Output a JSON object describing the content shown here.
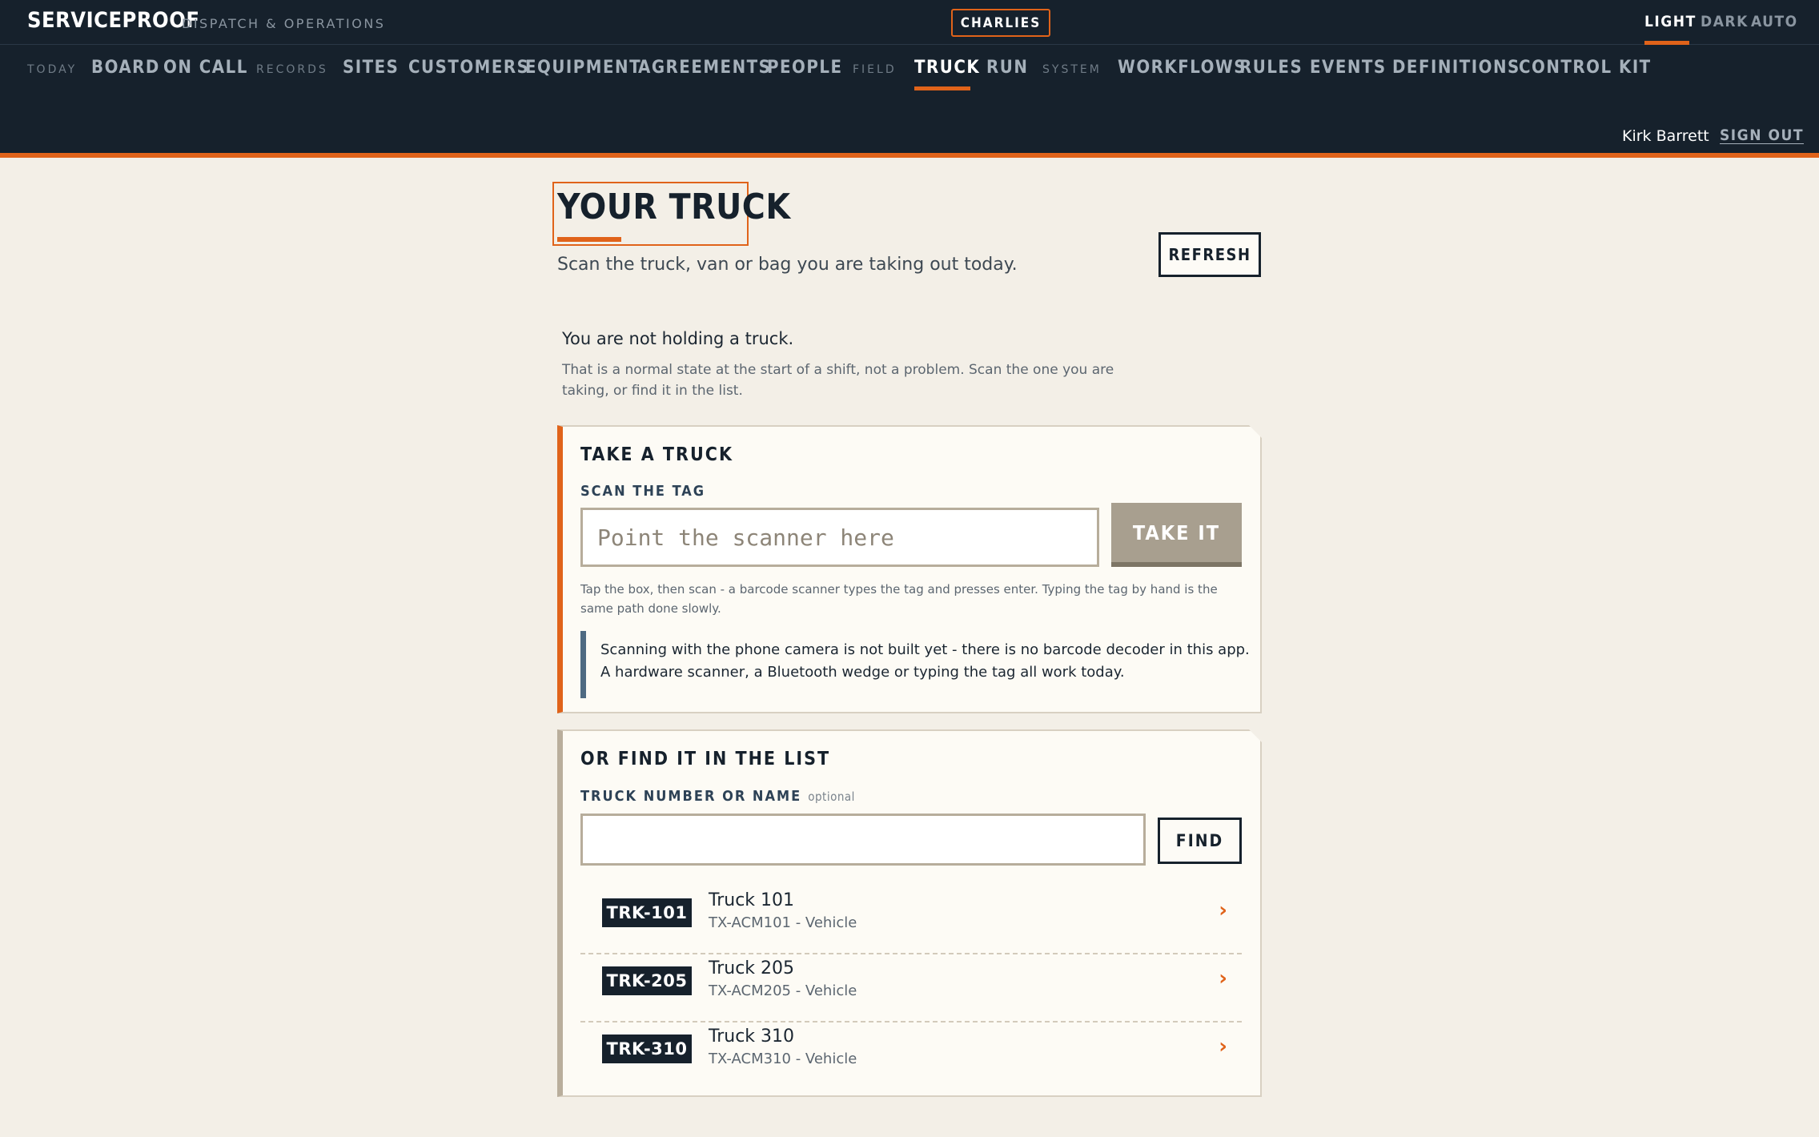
{
  "brand": {
    "name": "SERVICEPROOF",
    "tagline": "DISPATCH & OPERATIONS",
    "tenant": "CHARLIES"
  },
  "theme": {
    "options": [
      "LIGHT",
      "DARK",
      "AUTO"
    ],
    "active": "LIGHT"
  },
  "nav": {
    "groups": {
      "today": "TODAY",
      "records": "RECORDS",
      "field": "FIELD",
      "system": "SYSTEM"
    },
    "items": {
      "board": "BOARD",
      "on_call": "ON CALL",
      "sites": "SITES",
      "customers": "CUSTOMERS",
      "equipment": "EQUIPMENT",
      "agreements": "AGREEMENTS",
      "people": "PEOPLE",
      "truck": "TRUCK",
      "run": "RUN",
      "workflows": "WORKFLOWS",
      "rules": "RULES",
      "events": "EVENTS",
      "definitions": "DEFINITIONS",
      "control_kit": "CONTROL KIT"
    },
    "active": "TRUCK"
  },
  "user": {
    "name": "Kirk Barrett",
    "sign_out": "SIGN OUT"
  },
  "page": {
    "title": "YOUR TRUCK",
    "subtitle": "Scan the truck, van or bag you are taking out today.",
    "refresh": "REFRESH",
    "state": "You are not holding a truck.",
    "state_note": "That is a normal state at the start of a shift, not a problem. Scan the one you are taking, or find it in the list."
  },
  "take_card": {
    "title": "TAKE A TRUCK",
    "label": "SCAN THE TAG",
    "placeholder": "Point the scanner here",
    "value": "",
    "button": "TAKE IT",
    "hint": "Tap the box, then scan - a barcode scanner types the tag and presses enter. Typing the tag by hand is the same path done slowly.",
    "notice": "Scanning with the phone camera is not built yet - there is no barcode decoder in this app. A hardware scanner, a Bluetooth wedge or typing the tag all work today."
  },
  "find_card": {
    "title": "OR FIND IT IN THE LIST",
    "label": "TRUCK NUMBER OR NAME",
    "optional": "optional",
    "value": "",
    "button": "FIND",
    "trucks": [
      {
        "tag": "TRK-101",
        "name": "Truck 101",
        "meta": "TX-ACM101 - Vehicle"
      },
      {
        "tag": "TRK-205",
        "name": "Truck 205",
        "meta": "TX-ACM205 - Vehicle"
      },
      {
        "tag": "TRK-310",
        "name": "Truck 310",
        "meta": "TX-ACM310 - Vehicle"
      }
    ],
    "chevron": "›"
  },
  "colors": {
    "accent": "#e0631a",
    "nav_bg": "#16212c",
    "page_bg": "#f3efe7",
    "card_bg": "#fdfbf5"
  }
}
